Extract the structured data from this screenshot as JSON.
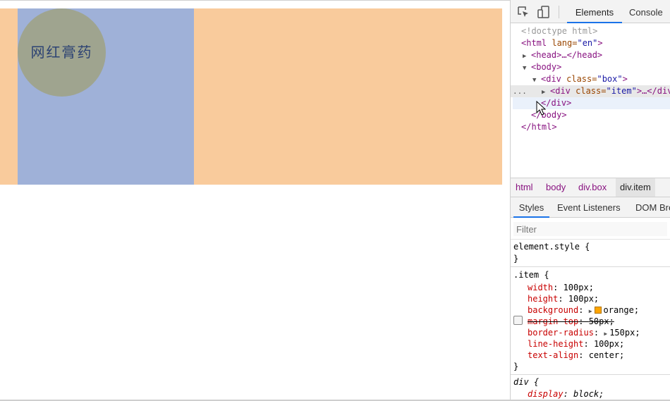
{
  "page": {
    "item_text": "网红膏药",
    "colors": {
      "box": "#f9cb9c",
      "overlay": "#9fb1d8",
      "item": "#9fa48f",
      "item_text": "#2d4373"
    }
  },
  "devtools": {
    "tabs": {
      "elements": "Elements",
      "console": "Console"
    },
    "dom": {
      "doctype": "<!doctype html>",
      "html_open_tag": "<html",
      "html_attr": " lang=",
      "html_val": "\"en\"",
      "html_close": ">",
      "head": "<head>…</head>",
      "body_open": "<body>",
      "div_box_tag": "<div",
      "div_box_attr": " class=",
      "div_box_val": "\"box\"",
      "div_box_end": ">",
      "div_item_tag": "<div",
      "div_item_attr": " class=",
      "div_item_val": "\"item\"",
      "div_item_end": ">…</div>",
      "div_close": "</div>",
      "body_close": "</body>",
      "html_close_tag": "</html>",
      "dots": "..."
    },
    "breadcrumb": [
      "html",
      "body",
      "div.box",
      "div.item"
    ],
    "styles_tabs": [
      "Styles",
      "Event Listeners",
      "DOM Breakpoints"
    ],
    "filter_placeholder": "Filter",
    "rules": {
      "element_style_selector": "element.style {",
      "close_brace": "}",
      "item_selector": ".item {",
      "item_props": [
        {
          "name": "width",
          "value": "100px;"
        },
        {
          "name": "height",
          "value": "100px;"
        },
        {
          "name": "background",
          "value": "orange;"
        },
        {
          "name": "margin-top",
          "value": "50px;"
        },
        {
          "name": "border-radius",
          "value": "150px;"
        },
        {
          "name": "line-height",
          "value": "100px;"
        },
        {
          "name": "text-align",
          "value": "center;"
        }
      ],
      "div_selector": "div {",
      "div_props": [
        {
          "name": "display",
          "value": "block;"
        }
      ]
    }
  }
}
